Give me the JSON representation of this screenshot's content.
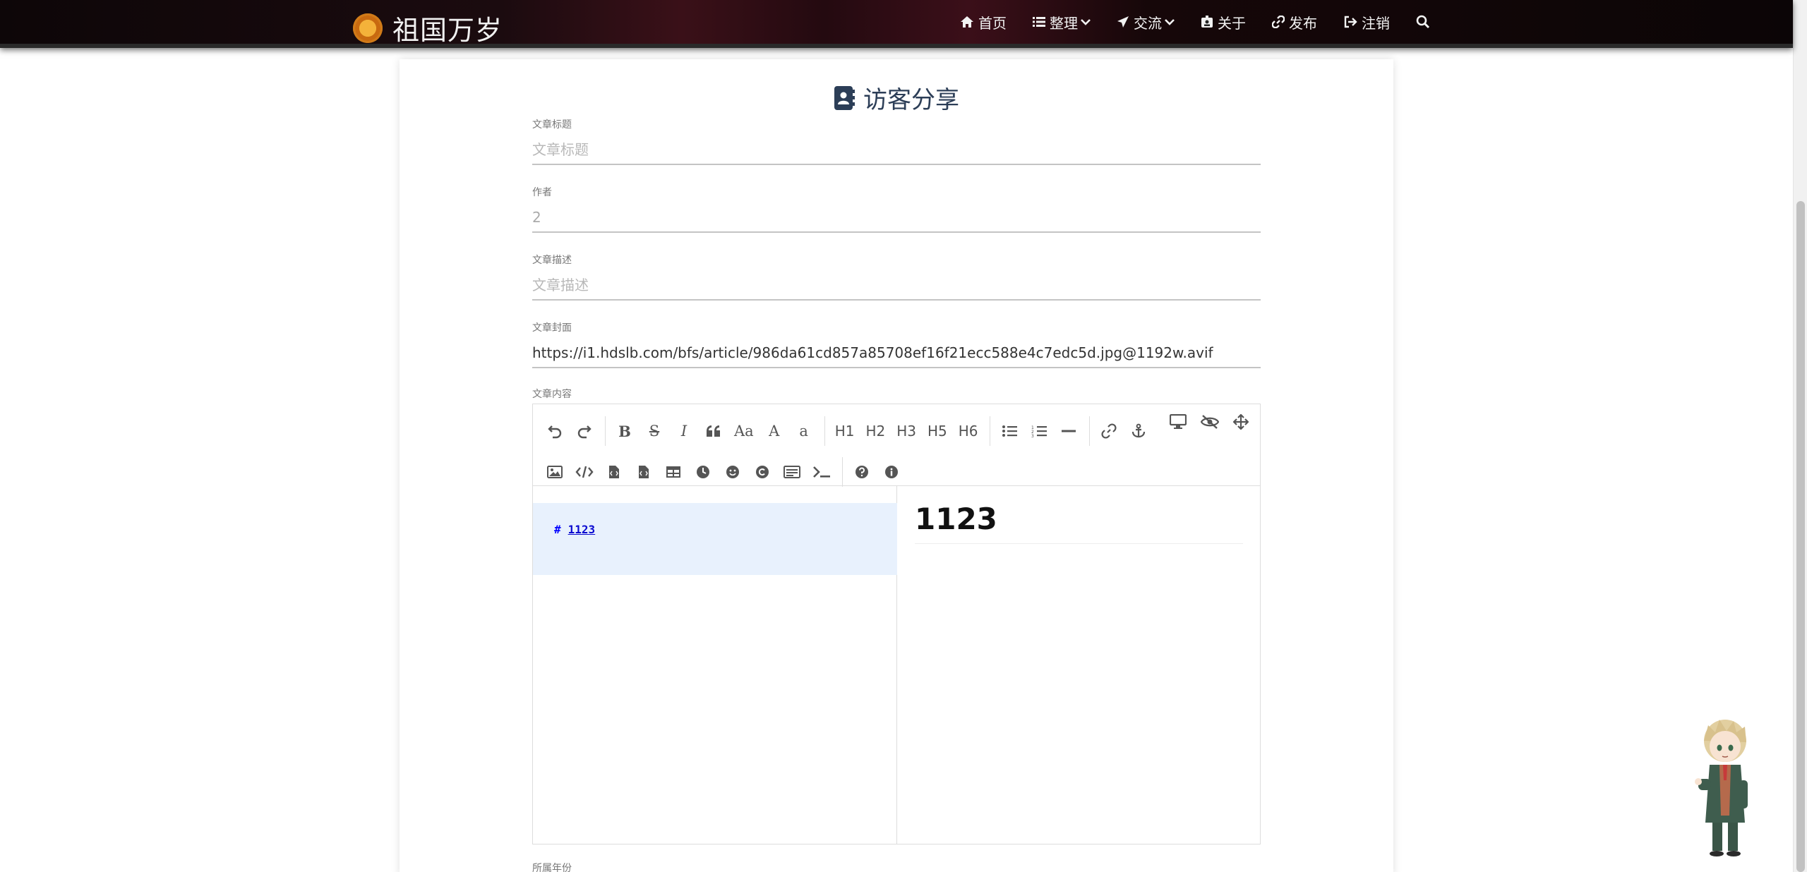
{
  "site": {
    "title": "祖国万岁"
  },
  "nav": {
    "items": [
      {
        "label": "首页",
        "icon": "home-icon"
      },
      {
        "label": "整理",
        "icon": "list-icon",
        "dropdown": true
      },
      {
        "label": "交流",
        "icon": "paper-plane-icon",
        "dropdown": true
      },
      {
        "label": "关于",
        "icon": "id-badge-icon"
      },
      {
        "label": "发布",
        "icon": "link-icon"
      },
      {
        "label": "注销",
        "icon": "sign-out-icon"
      }
    ],
    "search_icon": "search-icon"
  },
  "page": {
    "heading": "访客分享"
  },
  "form": {
    "title": {
      "label": "文章标题",
      "placeholder": "文章标题",
      "value": ""
    },
    "author": {
      "label": "作者",
      "value": "2"
    },
    "description": {
      "label": "文章描述",
      "placeholder": "文章描述",
      "value": ""
    },
    "cover": {
      "label": "文章封面",
      "value": "https://i1.hdslb.com/bfs/article/986da61cd857a85708ef16f21ecc588e4c7edc5d.jpg@1192w.avif"
    },
    "content": {
      "label": "文章内容"
    },
    "year": {
      "label": "所属年份"
    }
  },
  "toolbar": {
    "row1": [
      "undo",
      "redo",
      "B",
      "S",
      "I",
      "quote",
      "Aa",
      "A",
      "a",
      "H1",
      "H2",
      "H3",
      "H5",
      "H6",
      "ul",
      "ol",
      "hr",
      "link",
      "anchor"
    ],
    "right": [
      "desktop-icon",
      "eye-slash-icon",
      "arrows-icon"
    ],
    "row2": [
      "image-icon",
      "code-icon",
      "file-code-icon",
      "file-code-icon",
      "table-icon",
      "clock-icon",
      "smile-icon",
      "copyright-icon",
      "page-break-icon",
      "terminal-icon",
      "help-icon",
      "info-icon"
    ],
    "labels": {
      "bold": "B",
      "strike": "S",
      "italic": "I",
      "case_upper": "Aa",
      "upper": "A",
      "lower": "a",
      "h1": "H1",
      "h2": "H2",
      "h3": "H3",
      "h5": "H5",
      "h6": "H6"
    }
  },
  "editor": {
    "source_hash": "#",
    "source_text": "1123",
    "preview_heading": "1123"
  },
  "colors": {
    "heading": "#2c3e57",
    "nav_bg": "#1b0b0f",
    "code_highlight": "#e8f1fd",
    "code_text": "#0000ff"
  }
}
